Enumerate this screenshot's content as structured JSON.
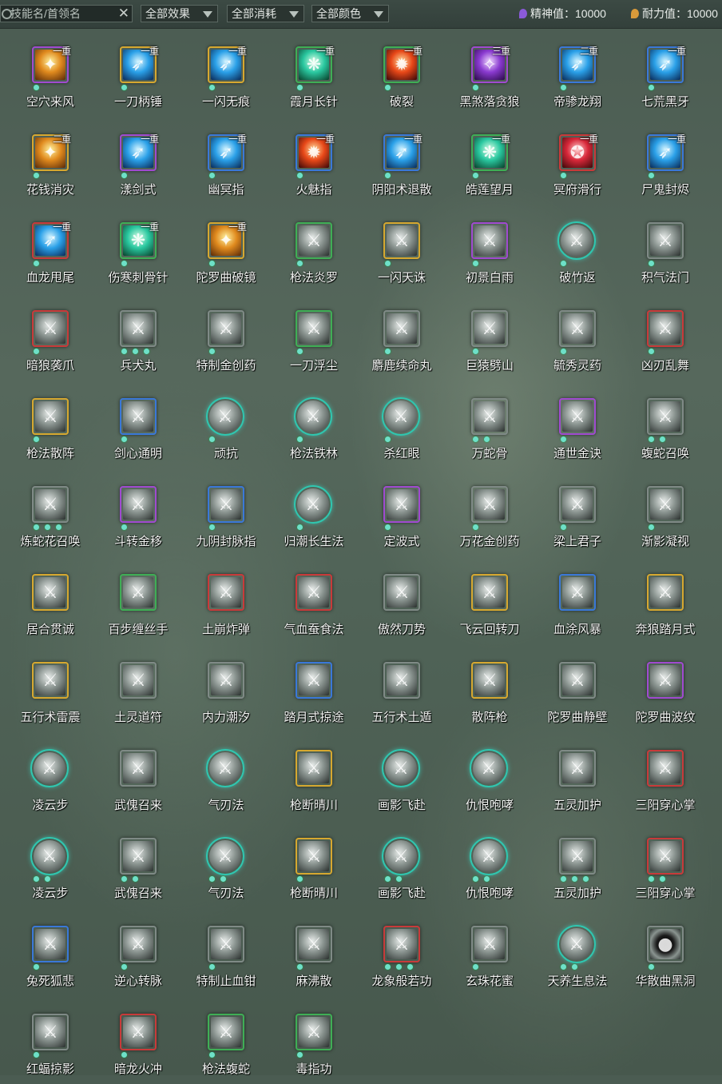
{
  "filters": {
    "search_placeholder": "技能名/首领名",
    "clear_symbol": "✕",
    "effect": "全部效果",
    "cost": "全部消耗",
    "color": "全部颜色"
  },
  "stats": {
    "spirit": "精神值：10000",
    "endurance": "耐力值：10000"
  },
  "colors": {
    "purple": "#a04ad0",
    "gold": "#d6a830",
    "blue": "#3a78d8",
    "green": "#3fae55",
    "red": "#c83a3a",
    "grey": "#7f8a86",
    "teal": "#2fc7b0"
  },
  "skills": [
    {
      "name": "空穴来风",
      "tier": "一重",
      "border": "purple",
      "art": "color",
      "dots": 1
    },
    {
      "name": "一刀柄锤",
      "tier": "一重",
      "border": "gold",
      "art": "blue",
      "dots": 1
    },
    {
      "name": "一闪无痕",
      "tier": "一重",
      "border": "gold",
      "art": "blue",
      "dots": 1
    },
    {
      "name": "霞月长针",
      "tier": "一重",
      "border": "green",
      "art": "green",
      "dots": 1
    },
    {
      "name": "破裂",
      "tier": "一重",
      "border": "green",
      "art": "fire",
      "dots": 1
    },
    {
      "name": "黑煞落贪狼",
      "tier": "三重",
      "border": "purple",
      "art": "purple",
      "dots": 1
    },
    {
      "name": "帝骖龙翔",
      "tier": "二重",
      "border": "blue",
      "art": "blue",
      "dots": 1
    },
    {
      "name": "七荒黑牙",
      "tier": "一重",
      "border": "blue",
      "art": "blue",
      "dots": 1
    },
    {
      "name": "花钱消灾",
      "tier": "二重",
      "border": "gold",
      "art": "color",
      "dots": 1
    },
    {
      "name": "漾剑式",
      "tier": "一重",
      "border": "purple",
      "art": "blue",
      "dots": 1
    },
    {
      "name": "幽冥指",
      "tier": "一重",
      "border": "blue",
      "art": "blue",
      "dots": 1
    },
    {
      "name": "火魅指",
      "tier": "一重",
      "border": "blue",
      "art": "fire",
      "dots": 1
    },
    {
      "name": "阴阳术退散",
      "tier": "一重",
      "border": "blue",
      "art": "blue",
      "dots": 1
    },
    {
      "name": "皓莲望月",
      "tier": "一重",
      "border": "green",
      "art": "green",
      "dots": 1
    },
    {
      "name": "冥府滑行",
      "tier": "一重",
      "border": "red",
      "art": "red",
      "dots": 1
    },
    {
      "name": "尸鬼封烬",
      "tier": "一重",
      "border": "blue",
      "art": "blue",
      "dots": 1
    },
    {
      "name": "血龙甩尾",
      "tier": "一重",
      "border": "red",
      "art": "blue",
      "dots": 1
    },
    {
      "name": "伤寒刺骨针",
      "tier": "一重",
      "border": "green",
      "art": "green",
      "dots": 1
    },
    {
      "name": "陀罗曲破镜",
      "tier": "一重",
      "border": "gold",
      "art": "color",
      "dots": 1
    },
    {
      "name": "枪法炎罗",
      "tier": "",
      "border": "green",
      "art": "gray",
      "dots": 1
    },
    {
      "name": "一闪天诛",
      "tier": "",
      "border": "gold",
      "art": "gray",
      "dots": 1
    },
    {
      "name": "初景白雨",
      "tier": "",
      "border": "purple",
      "art": "gray",
      "dots": 1
    },
    {
      "name": "破竹返",
      "tier": "",
      "border": "teal",
      "art": "gray",
      "dots": 1,
      "round": true
    },
    {
      "name": "积气法门",
      "tier": "",
      "border": "grey",
      "art": "gray",
      "dots": 1
    },
    {
      "name": "暗狼袭爪",
      "tier": "",
      "border": "red",
      "art": "gray",
      "dots": 1
    },
    {
      "name": "兵犬丸",
      "tier": "",
      "border": "grey",
      "art": "gray",
      "dots": 3
    },
    {
      "name": "特制金创药",
      "tier": "",
      "border": "grey",
      "art": "gray",
      "dots": 1
    },
    {
      "name": "一刀浮尘",
      "tier": "",
      "border": "green",
      "art": "gray",
      "dots": 1
    },
    {
      "name": "麝鹿续命丸",
      "tier": "",
      "border": "grey",
      "art": "gray",
      "dots": 1
    },
    {
      "name": "巨猿劈山",
      "tier": "",
      "border": "grey",
      "art": "gray",
      "dots": 1
    },
    {
      "name": "毓秀灵药",
      "tier": "",
      "border": "grey",
      "art": "gray",
      "dots": 1
    },
    {
      "name": "凶刃乱舞",
      "tier": "",
      "border": "red",
      "art": "gray",
      "dots": 1
    },
    {
      "name": "枪法散阵",
      "tier": "",
      "border": "gold",
      "art": "gray",
      "dots": 1
    },
    {
      "name": "剑心通明",
      "tier": "",
      "border": "blue",
      "art": "gray",
      "dots": 1
    },
    {
      "name": "顽抗",
      "tier": "",
      "border": "teal",
      "art": "gray",
      "dots": 1,
      "round": true
    },
    {
      "name": "枪法铁林",
      "tier": "",
      "border": "teal",
      "art": "gray",
      "dots": 1,
      "round": true
    },
    {
      "name": "杀红眼",
      "tier": "",
      "border": "teal",
      "art": "gray",
      "dots": 1,
      "round": true
    },
    {
      "name": "万蛇骨",
      "tier": "",
      "border": "grey",
      "art": "gray",
      "dots": 2
    },
    {
      "name": "通世金诀",
      "tier": "",
      "border": "purple",
      "art": "gray",
      "dots": 1
    },
    {
      "name": "蝮蛇召唤",
      "tier": "",
      "border": "grey",
      "art": "gray",
      "dots": 2
    },
    {
      "name": "炼蛇花召唤",
      "tier": "",
      "border": "grey",
      "art": "gray",
      "dots": 3
    },
    {
      "name": "斗转金移",
      "tier": "",
      "border": "purple",
      "art": "gray",
      "dots": 1
    },
    {
      "name": "九阴封脉指",
      "tier": "",
      "border": "blue",
      "art": "gray",
      "dots": 1
    },
    {
      "name": "归潮长生法",
      "tier": "",
      "border": "teal",
      "art": "gray",
      "dots": 1,
      "round": true
    },
    {
      "name": "定波式",
      "tier": "",
      "border": "purple",
      "art": "gray",
      "dots": 1
    },
    {
      "name": "万花金创药",
      "tier": "",
      "border": "grey",
      "art": "gray",
      "dots": 1
    },
    {
      "name": "梁上君子",
      "tier": "",
      "border": "grey",
      "art": "gray",
      "dots": 1
    },
    {
      "name": "渐影凝视",
      "tier": "",
      "border": "grey",
      "art": "gray",
      "dots": 1
    },
    {
      "name": "居合贯诚",
      "tier": "",
      "border": "gold",
      "art": "gray",
      "dots": 0
    },
    {
      "name": "百步缠丝手",
      "tier": "",
      "border": "green",
      "art": "gray",
      "dots": 0
    },
    {
      "name": "土崩炸弹",
      "tier": "",
      "border": "red",
      "art": "gray",
      "dots": 0
    },
    {
      "name": "气血蚕食法",
      "tier": "",
      "border": "red",
      "art": "gray",
      "dots": 0
    },
    {
      "name": "傲然刀势",
      "tier": "",
      "border": "grey",
      "art": "gray",
      "dots": 0
    },
    {
      "name": "飞云回转刀",
      "tier": "",
      "border": "gold",
      "art": "gray",
      "dots": 0
    },
    {
      "name": "血涂风暴",
      "tier": "",
      "border": "blue",
      "art": "gray",
      "dots": 0
    },
    {
      "name": "奔狼踏月式",
      "tier": "",
      "border": "gold",
      "art": "gray",
      "dots": 0
    },
    {
      "name": "五行术雷震",
      "tier": "",
      "border": "gold",
      "art": "gray",
      "dots": 0
    },
    {
      "name": "土灵道符",
      "tier": "",
      "border": "grey",
      "art": "gray",
      "dots": 0
    },
    {
      "name": "内力潮汐",
      "tier": "",
      "border": "grey",
      "art": "gray",
      "dots": 0
    },
    {
      "name": "踏月式掠途",
      "tier": "",
      "border": "blue",
      "art": "gray",
      "dots": 0
    },
    {
      "name": "五行术土遁",
      "tier": "",
      "border": "grey",
      "art": "gray",
      "dots": 0
    },
    {
      "name": "散阵枪",
      "tier": "",
      "border": "gold",
      "art": "gray",
      "dots": 0
    },
    {
      "name": "陀罗曲静壁",
      "tier": "",
      "border": "grey",
      "art": "gray",
      "dots": 0
    },
    {
      "name": "陀罗曲波纹",
      "tier": "",
      "border": "purple",
      "art": "gray",
      "dots": 0
    },
    {
      "name": "凌云步",
      "tier": "",
      "border": "teal",
      "art": "gray",
      "dots": 0,
      "round": true
    },
    {
      "name": "武傀召来",
      "tier": "",
      "border": "grey",
      "art": "gray",
      "dots": 0
    },
    {
      "name": "气刃法",
      "tier": "",
      "border": "teal",
      "art": "gray",
      "dots": 0,
      "round": true
    },
    {
      "name": "枪断晴川",
      "tier": "",
      "border": "gold",
      "art": "gray",
      "dots": 0
    },
    {
      "name": "画影飞赴",
      "tier": "",
      "border": "teal",
      "art": "gray",
      "dots": 0,
      "round": true
    },
    {
      "name": "仇恨咆哮",
      "tier": "",
      "border": "teal",
      "art": "gray",
      "dots": 0,
      "round": true
    },
    {
      "name": "五灵加护",
      "tier": "",
      "border": "grey",
      "art": "gray",
      "dots": 0
    },
    {
      "name": "三阳穿心掌",
      "tier": "",
      "border": "red",
      "art": "gray",
      "dots": 0
    },
    {
      "name": "凌云步",
      "tier": "",
      "border": "teal",
      "art": "gray",
      "dots": 2,
      "round": true
    },
    {
      "name": "武傀召来",
      "tier": "",
      "border": "grey",
      "art": "gray",
      "dots": 2
    },
    {
      "name": "气刃法",
      "tier": "",
      "border": "teal",
      "art": "gray",
      "dots": 2,
      "round": true
    },
    {
      "name": "枪断晴川",
      "tier": "",
      "border": "gold",
      "art": "gray",
      "dots": 1
    },
    {
      "name": "画影飞赴",
      "tier": "",
      "border": "teal",
      "art": "gray",
      "dots": 2,
      "round": true
    },
    {
      "name": "仇恨咆哮",
      "tier": "",
      "border": "teal",
      "art": "gray",
      "dots": 2,
      "round": true
    },
    {
      "name": "五灵加护",
      "tier": "",
      "border": "grey",
      "art": "gray",
      "dots": 3
    },
    {
      "name": "三阳穿心掌",
      "tier": "",
      "border": "red",
      "art": "gray",
      "dots": 2
    },
    {
      "name": "兔死狐悲",
      "tier": "",
      "border": "blue",
      "art": "gray",
      "dots": 1
    },
    {
      "name": "逆心转脉",
      "tier": "",
      "border": "grey",
      "art": "gray",
      "dots": 1
    },
    {
      "name": "特制止血钳",
      "tier": "",
      "border": "grey",
      "art": "gray",
      "dots": 1
    },
    {
      "name": "麻沸散",
      "tier": "",
      "border": "grey",
      "art": "gray",
      "dots": 1
    },
    {
      "name": "龙象般若功",
      "tier": "",
      "border": "red",
      "art": "gray",
      "dots": 3
    },
    {
      "name": "玄珠花蜜",
      "tier": "",
      "border": "grey",
      "art": "gray",
      "dots": 1
    },
    {
      "name": "天养生息法",
      "tier": "",
      "border": "teal",
      "art": "gray",
      "dots": 2,
      "round": true
    },
    {
      "name": "华散曲黑洞",
      "tier": "",
      "border": "grey",
      "art": "dark",
      "dots": 1
    },
    {
      "name": "红蝠掠影",
      "tier": "",
      "border": "grey",
      "art": "gray",
      "dots": 1
    },
    {
      "name": "暗龙火冲",
      "tier": "",
      "border": "red",
      "art": "gray",
      "dots": 1
    },
    {
      "name": "枪法蝮蛇",
      "tier": "",
      "border": "green",
      "art": "gray",
      "dots": 1
    },
    {
      "name": "毒指功",
      "tier": "",
      "border": "green",
      "art": "gray",
      "dots": 1
    }
  ]
}
